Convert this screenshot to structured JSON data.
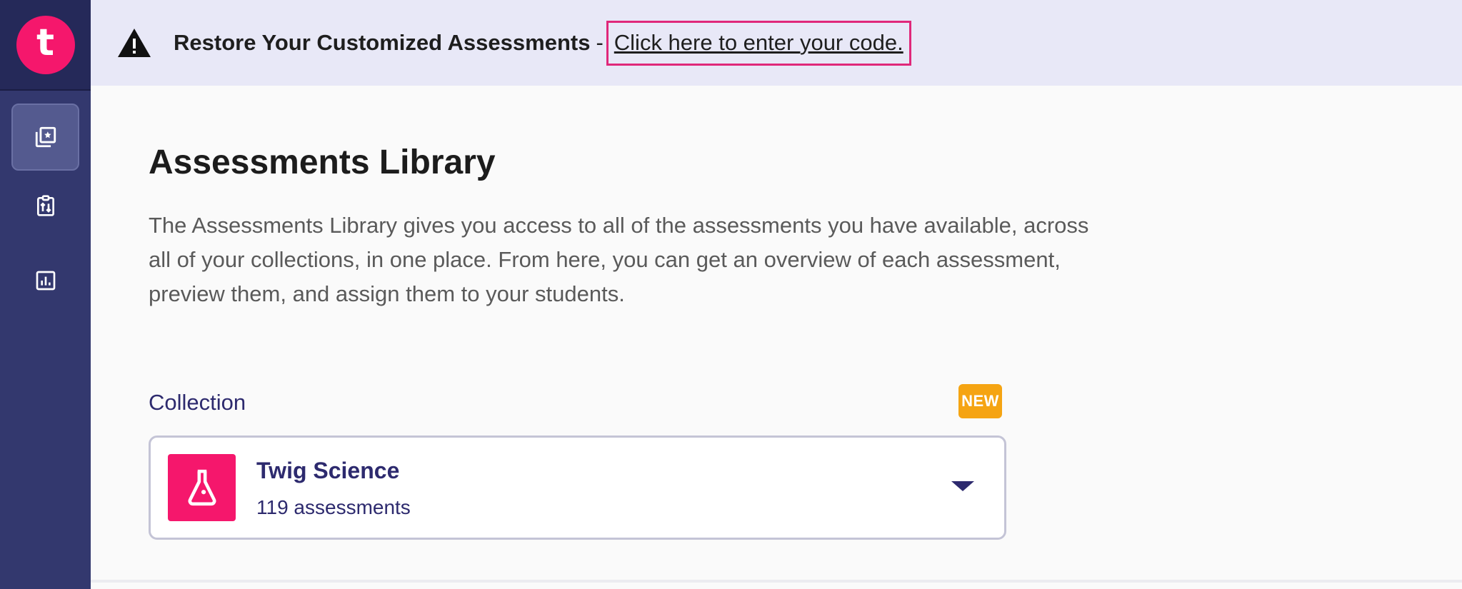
{
  "app": {
    "logo_letter": "t"
  },
  "banner": {
    "title": "Restore Your Customized Assessments",
    "separator": "-",
    "link_text": "Click here to enter your code."
  },
  "page": {
    "title": "Assessments Library",
    "description": "The Assessments Library gives you access to all of the assessments you have available, across all of your collections, in one place. From here, you can get an overview of each assessment, preview them, and assign them to your students."
  },
  "collection": {
    "label": "Collection",
    "badge": "NEW",
    "selected": {
      "name": "Twig Science",
      "count": "119 assessments"
    }
  },
  "colors": {
    "sidebar": "#33386e",
    "brand_pink": "#f5176c",
    "badge_orange": "#f5a412",
    "banner_bg": "#e8e8f7",
    "text_indigo": "#2d2a6e"
  },
  "icons": {
    "nav": [
      "library-star-icon",
      "clipboard-sort-icon",
      "bar-chart-icon"
    ],
    "collection": "flask-icon",
    "banner": "warning-icon"
  }
}
